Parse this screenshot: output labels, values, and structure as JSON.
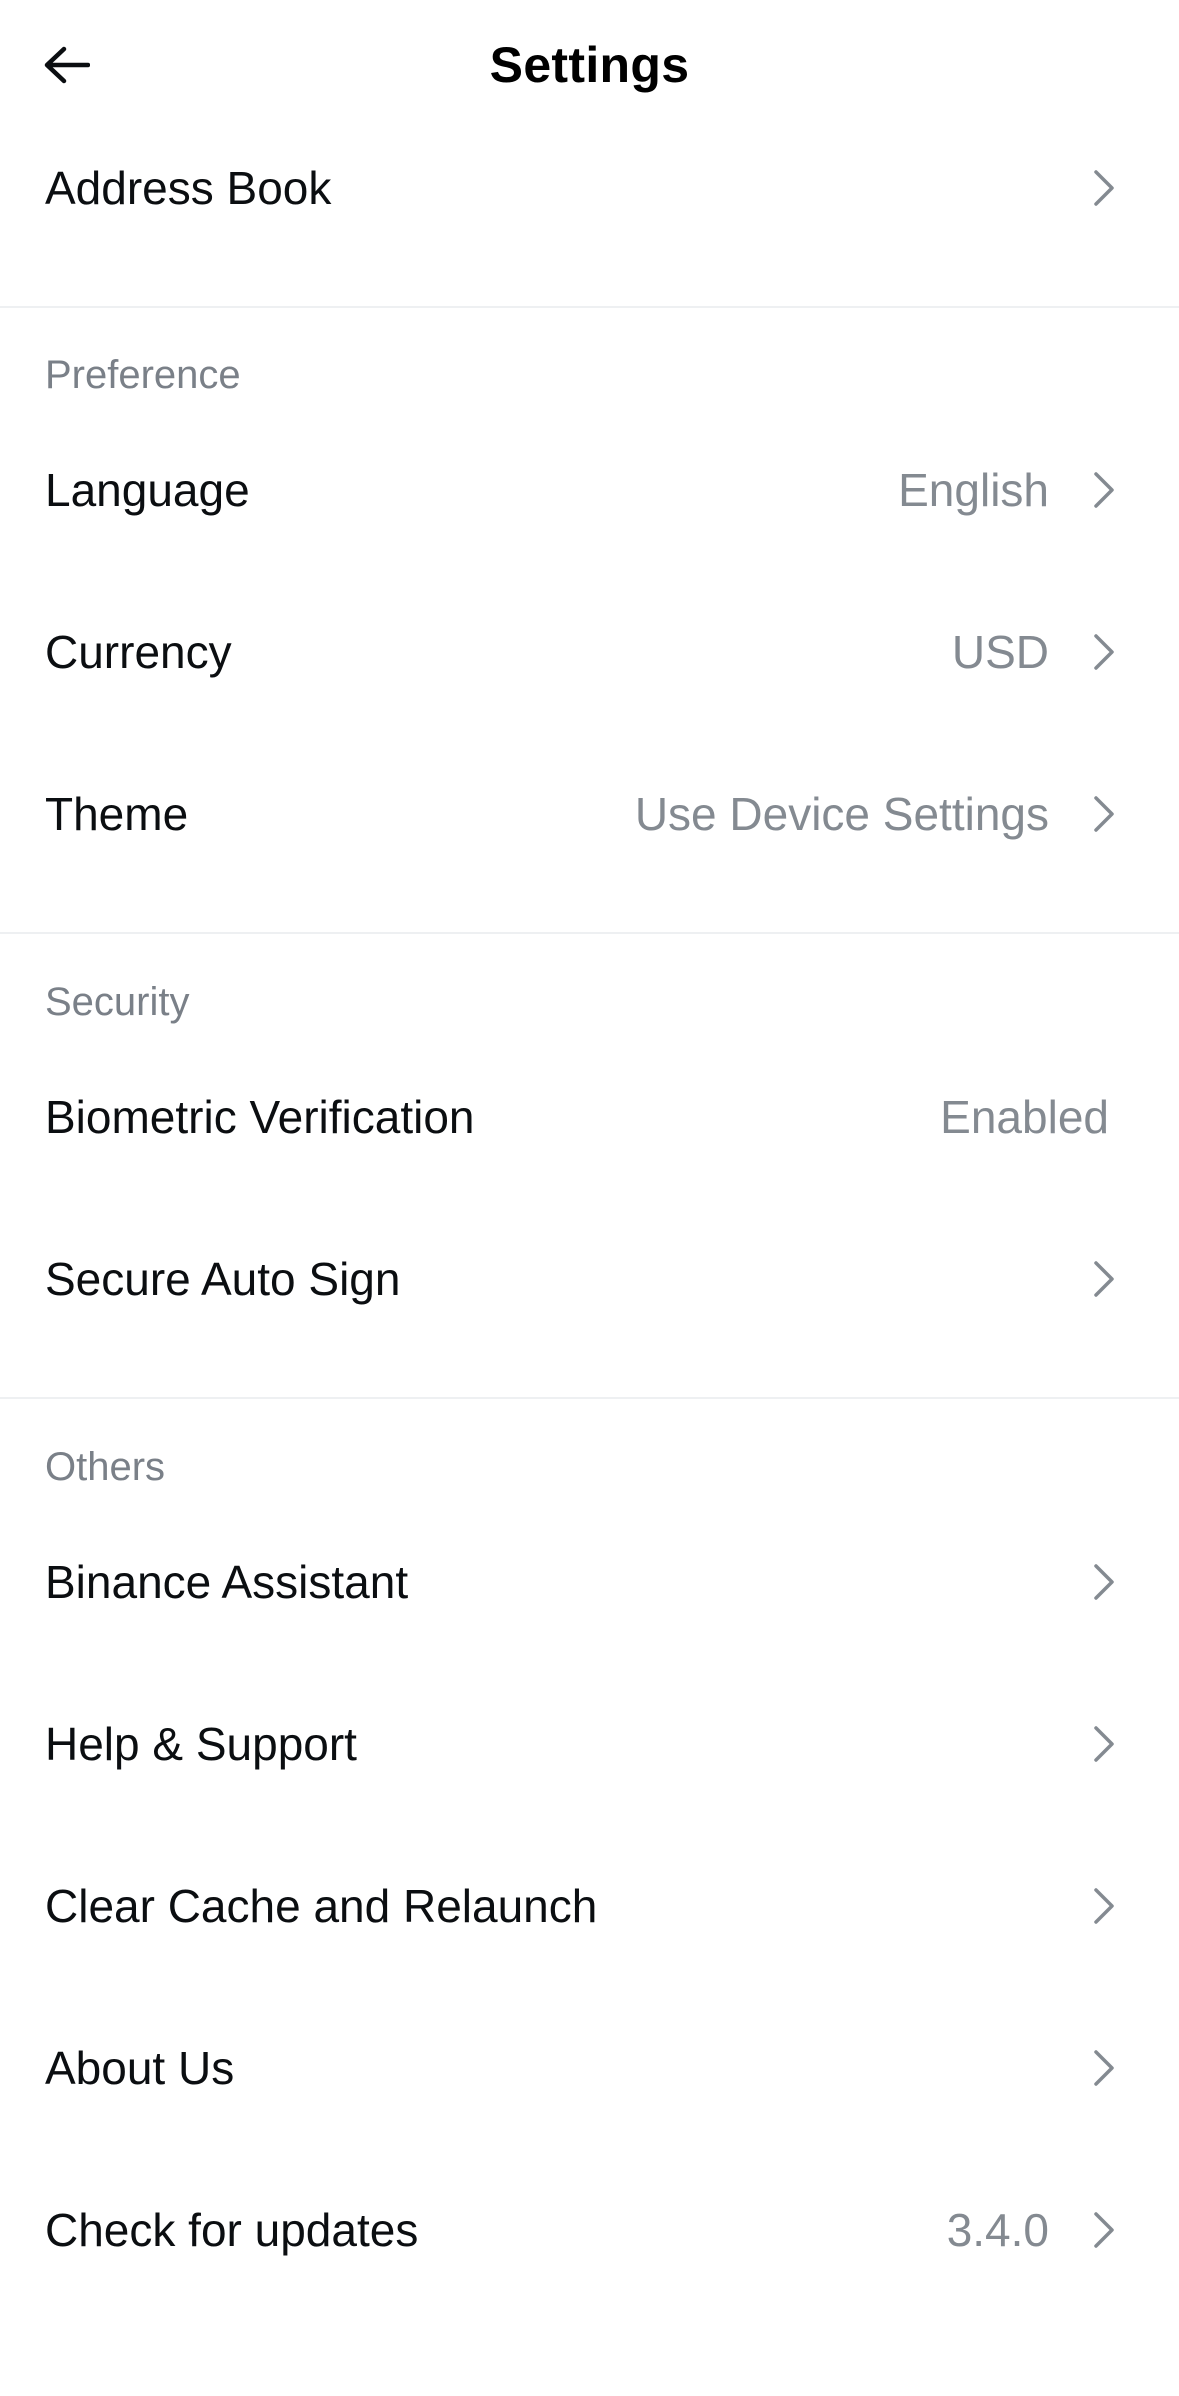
{
  "header": {
    "title": "Settings"
  },
  "rows": {
    "address_book": {
      "label": "Address Book"
    },
    "language": {
      "label": "Language",
      "value": "English"
    },
    "currency": {
      "label": "Currency",
      "value": "USD"
    },
    "theme": {
      "label": "Theme",
      "value": "Use Device Settings"
    },
    "biometric": {
      "label": "Biometric Verification",
      "value": "Enabled"
    },
    "auto_sign": {
      "label": "Secure Auto Sign"
    },
    "assistant": {
      "label": "Binance Assistant"
    },
    "help": {
      "label": "Help & Support"
    },
    "clear_cache": {
      "label": "Clear Cache and Relaunch"
    },
    "about": {
      "label": "About Us"
    },
    "updates": {
      "label": "Check for updates",
      "value": "3.4.0"
    }
  },
  "sections": {
    "preference": "Preference",
    "security": "Security",
    "others": "Others"
  },
  "icons": {
    "back": "arrow-left-icon",
    "chevron": "chevron-right-icon"
  },
  "colors": {
    "text_primary": "#0b0e11",
    "text_secondary": "#848a91",
    "section_title": "#7a8088",
    "divider": "#eef0f2",
    "background": "#ffffff"
  }
}
